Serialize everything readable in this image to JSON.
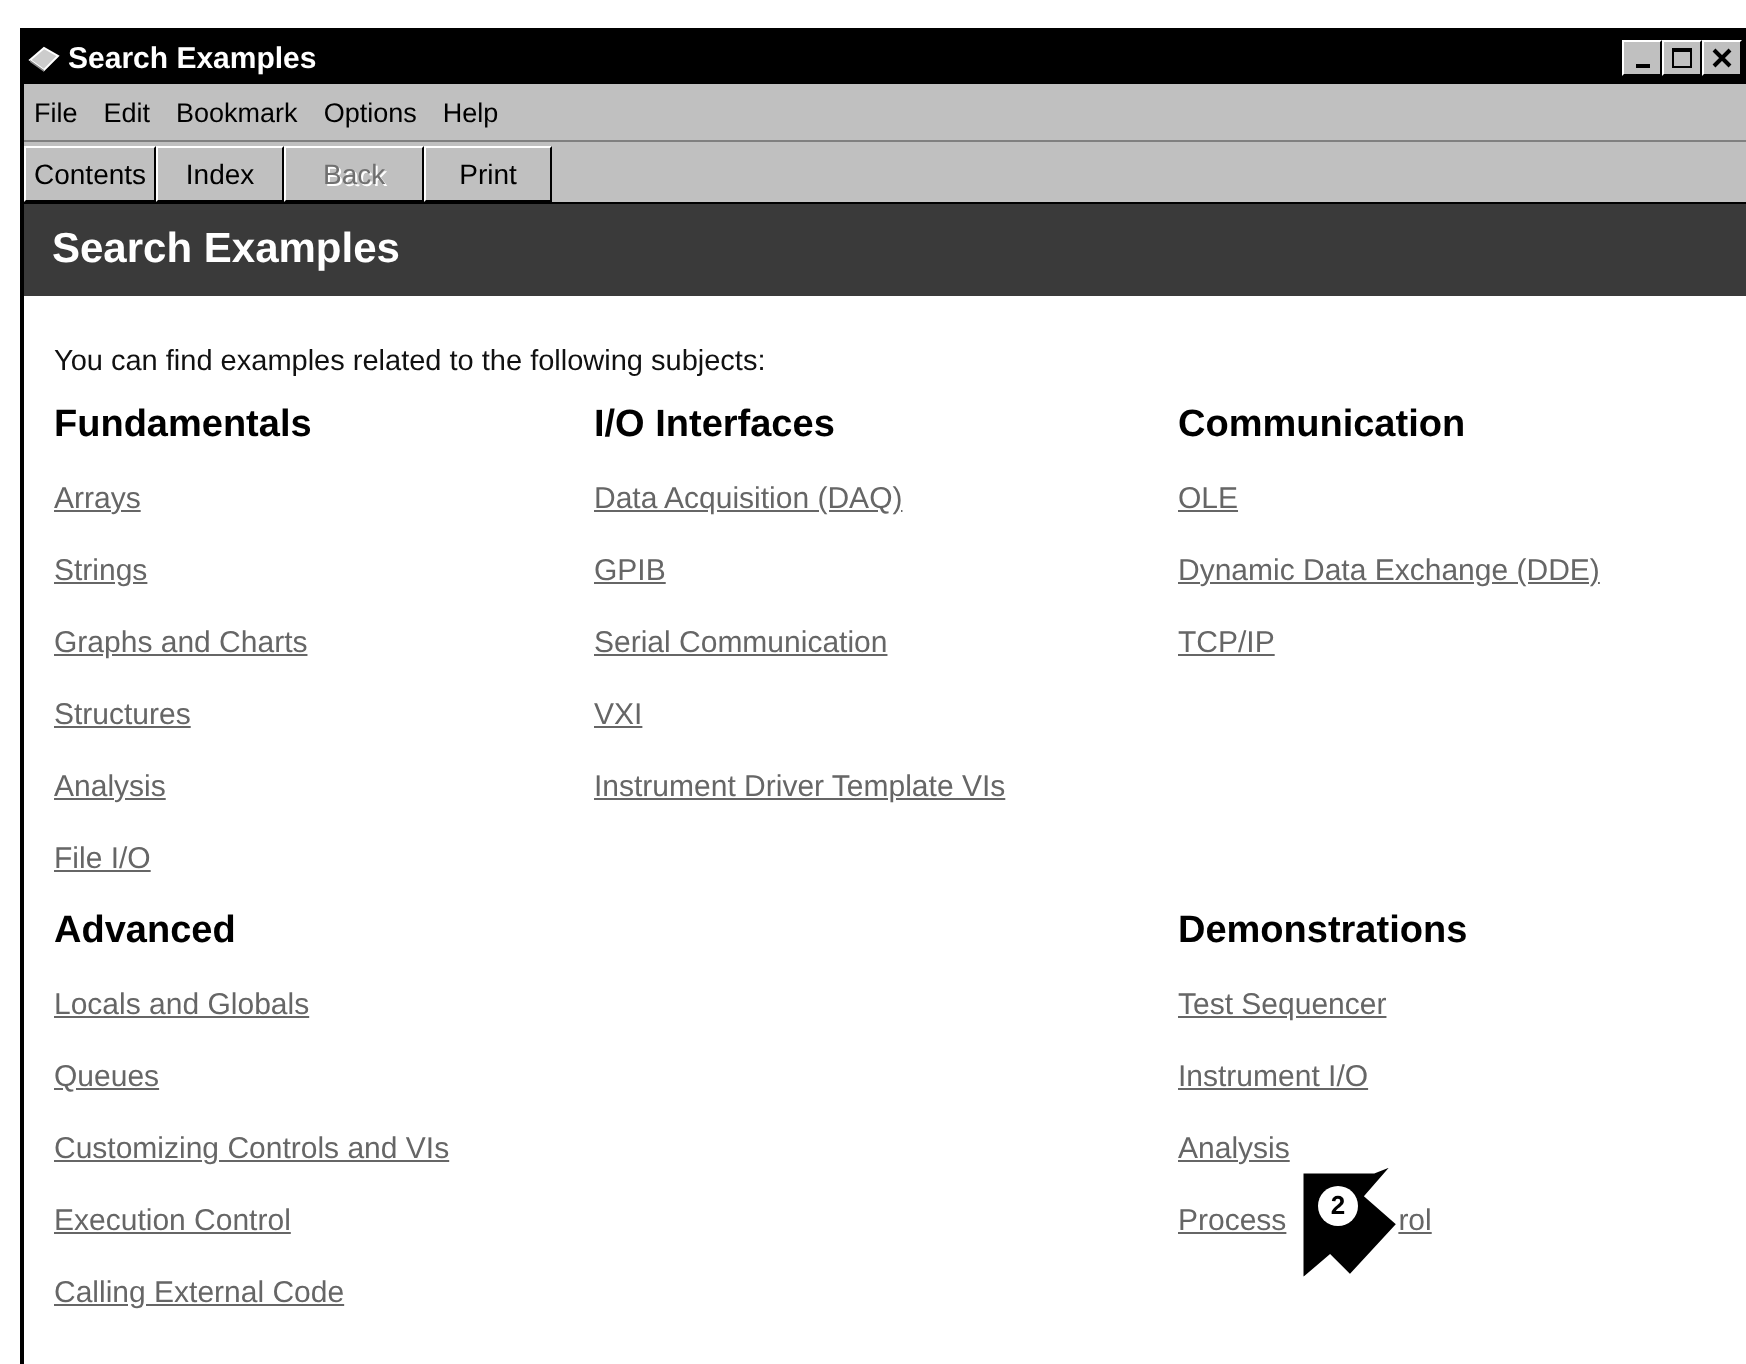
{
  "window": {
    "title": "Search Examples"
  },
  "menu": [
    {
      "label": "File"
    },
    {
      "label": "Edit"
    },
    {
      "label": "Bookmark"
    },
    {
      "label": "Options"
    },
    {
      "label": "Help"
    }
  ],
  "toolbar": [
    {
      "label": "Contents",
      "disabled": false
    },
    {
      "label": "Index",
      "disabled": false
    },
    {
      "label": "Back",
      "disabled": true
    },
    {
      "label": "Print",
      "disabled": false
    }
  ],
  "header": "Search Examples",
  "intro": "You can find examples related to the following subjects:",
  "rows": [
    {
      "left": {
        "heading": "Fundamentals",
        "links": [
          "Arrays",
          "Strings",
          "Graphs and Charts",
          "Structures",
          "Analysis",
          "File I/O"
        ]
      },
      "middle": {
        "heading": "I/O Interfaces",
        "links": [
          "Data Acquisition (DAQ)",
          "GPIB",
          "Serial Communication",
          "VXI",
          "Instrument Driver Template VIs"
        ]
      },
      "right": {
        "heading": "Communication",
        "links": [
          "OLE",
          "Dynamic Data Exchange (DDE)",
          "TCP/IP"
        ]
      }
    },
    {
      "left": {
        "heading": "Advanced",
        "links": [
          "Locals and Globals",
          "Queues",
          "Customizing Controls and VIs",
          "Execution Control",
          "Calling External Code"
        ]
      },
      "right": {
        "heading": "Demonstrations",
        "links": [
          "Test Sequencer",
          "Instrument I/O",
          "Analysis",
          [
            "Process",
            "rol"
          ]
        ]
      }
    }
  ],
  "callout": {
    "label": "2"
  }
}
